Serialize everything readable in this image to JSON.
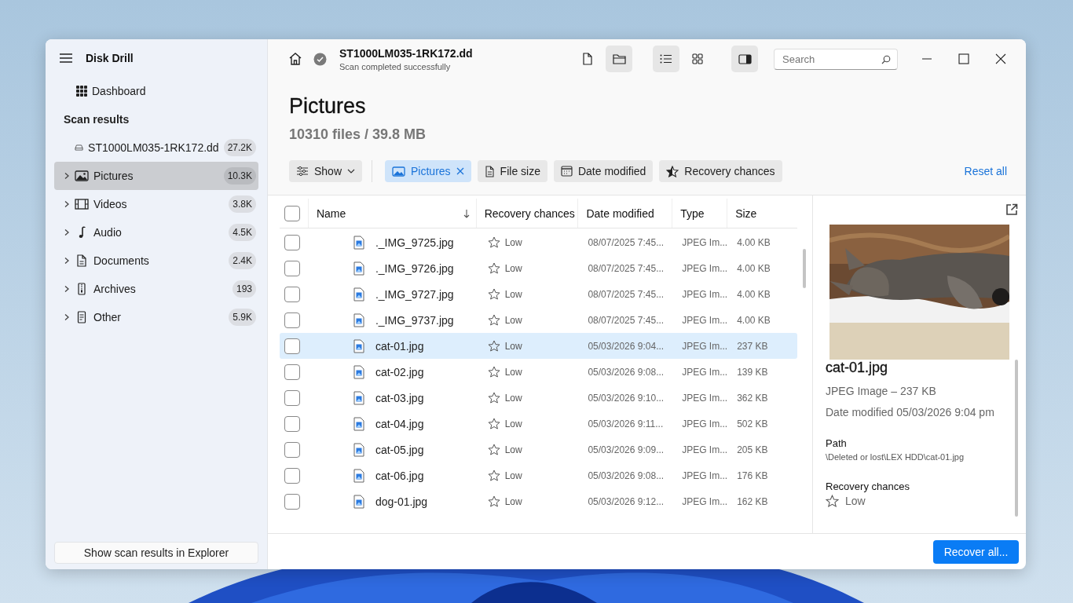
{
  "app": {
    "title": "Disk Drill"
  },
  "sidebar": {
    "dashboard": "Dashboard",
    "section": "Scan results",
    "drive": {
      "label": "ST1000LM035-1RK172.dd",
      "count": "27.2K"
    },
    "items": [
      {
        "label": "Pictures",
        "count": "10.3K",
        "kind": "pictures",
        "selected": true
      },
      {
        "label": "Videos",
        "count": "3.8K",
        "kind": "videos",
        "selected": false
      },
      {
        "label": "Audio",
        "count": "4.5K",
        "kind": "audio",
        "selected": false
      },
      {
        "label": "Documents",
        "count": "2.4K",
        "kind": "documents",
        "selected": false
      },
      {
        "label": "Archives",
        "count": "193",
        "kind": "archives",
        "selected": false
      },
      {
        "label": "Other",
        "count": "5.9K",
        "kind": "other",
        "selected": false
      }
    ],
    "explorer_button": "Show scan results in Explorer"
  },
  "header": {
    "title": "ST1000LM035-1RK172.dd",
    "subtitle": "Scan completed successfully"
  },
  "view_buttons": [
    {
      "kind": "file",
      "selected": false
    },
    {
      "kind": "folder",
      "selected": true
    },
    {
      "kind": "list",
      "selected": true
    },
    {
      "kind": "grid",
      "selected": false
    },
    {
      "kind": "preview",
      "selected": true
    }
  ],
  "search": {
    "placeholder": "Search"
  },
  "page": {
    "title": "Pictures",
    "summary": "10310 files / 39.8 MB"
  },
  "filters": [
    {
      "kind": "show",
      "label": "Show",
      "selected": false
    },
    {
      "kind": "pictures",
      "label": "Pictures",
      "selected": true
    },
    {
      "kind": "size",
      "label": "File size",
      "selected": false
    },
    {
      "kind": "date",
      "label": "Date modified",
      "selected": false
    },
    {
      "kind": "chances",
      "label": "Recovery chances",
      "selected": false
    }
  ],
  "reset": "Reset all",
  "table": {
    "select_all_checked": false,
    "columns": [
      "Name",
      "Recovery chances",
      "Date modified",
      "Type",
      "Size"
    ],
    "rows": [
      {
        "name": "._IMG_9725.jpg",
        "chances": "Low",
        "date": "08/07/2025 7:45...",
        "type": "JPEG Im...",
        "size": "4.00 KB",
        "checked": false,
        "selected": false
      },
      {
        "name": "._IMG_9726.jpg",
        "chances": "Low",
        "date": "08/07/2025 7:45...",
        "type": "JPEG Im...",
        "size": "4.00 KB",
        "checked": false,
        "selected": false
      },
      {
        "name": "._IMG_9727.jpg",
        "chances": "Low",
        "date": "08/07/2025 7:45...",
        "type": "JPEG Im...",
        "size": "4.00 KB",
        "checked": false,
        "selected": false
      },
      {
        "name": "._IMG_9737.jpg",
        "chances": "Low",
        "date": "08/07/2025 7:45...",
        "type": "JPEG Im...",
        "size": "4.00 KB",
        "checked": false,
        "selected": false
      },
      {
        "name": "cat-01.jpg",
        "chances": "Low",
        "date": "05/03/2026 9:04...",
        "type": "JPEG Im...",
        "size": "237 KB",
        "checked": false,
        "selected": true
      },
      {
        "name": "cat-02.jpg",
        "chances": "Low",
        "date": "05/03/2026 9:08...",
        "type": "JPEG Im...",
        "size": "139 KB",
        "checked": false,
        "selected": false
      },
      {
        "name": "cat-03.jpg",
        "chances": "Low",
        "date": "05/03/2026 9:10...",
        "type": "JPEG Im...",
        "size": "362 KB",
        "checked": false,
        "selected": false
      },
      {
        "name": "cat-04.jpg",
        "chances": "Low",
        "date": "05/03/2026 9:11...",
        "type": "JPEG Im...",
        "size": "502 KB",
        "checked": false,
        "selected": false
      },
      {
        "name": "cat-05.jpg",
        "chances": "Low",
        "date": "05/03/2026 9:09...",
        "type": "JPEG Im...",
        "size": "205 KB",
        "checked": false,
        "selected": false
      },
      {
        "name": "cat-06.jpg",
        "chances": "Low",
        "date": "05/03/2026 9:08...",
        "type": "JPEG Im...",
        "size": "176 KB",
        "checked": false,
        "selected": false
      },
      {
        "name": "dog-01.jpg",
        "chances": "Low",
        "date": "05/03/2026 9:12...",
        "type": "JPEG Im...",
        "size": "162 KB",
        "checked": false,
        "selected": false
      }
    ]
  },
  "preview": {
    "name": "cat-01.jpg",
    "meta": "JPEG Image – 237 KB",
    "date": "Date modified 05/03/2026 9:04 pm",
    "path_label": "Path",
    "path": "\\Deleted or lost\\LEX HDD\\cat-01.jpg",
    "chances_label": "Recovery chances",
    "chances": "Low"
  },
  "recover_button": "Recover all..."
}
